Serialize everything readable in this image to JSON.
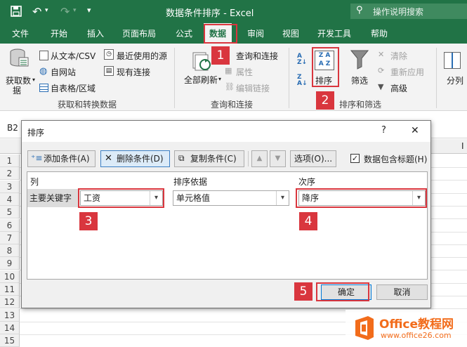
{
  "titlebar": {
    "window_title": "数据条件排序  -  Excel",
    "search_placeholder": "操作说明搜索"
  },
  "tabs": [
    {
      "label": "文件"
    },
    {
      "label": "开始"
    },
    {
      "label": "插入"
    },
    {
      "label": "页面布局"
    },
    {
      "label": "公式"
    },
    {
      "label": "数据"
    },
    {
      "label": "审阅"
    },
    {
      "label": "视图"
    },
    {
      "label": "开发工具"
    },
    {
      "label": "帮助"
    }
  ],
  "ribbon": {
    "get_data_line1": "获取数",
    "get_data_line2": "据",
    "from_text_csv": "从文本/CSV",
    "from_web": "自网站",
    "from_table": "自表格/区域",
    "recent_sources": "最近使用的源",
    "existing_connections": "现有连接",
    "group_get_transform": "获取和转换数据",
    "refresh_all": "全部刷新",
    "queries_connections": "查询和连接",
    "properties": "属性",
    "edit_links": "编辑链接",
    "group_queries": "查询和连接",
    "sort": "排序",
    "filter": "筛选",
    "clear": "清除",
    "reapply": "重新应用",
    "advanced": "高级",
    "group_sort_filter": "排序和筛选",
    "text_to_columns": "分列"
  },
  "sheet": {
    "name_box": "B2",
    "rows": [
      "1",
      "2",
      "3",
      "4",
      "5",
      "6",
      "7",
      "8",
      "9",
      "10",
      "11",
      "12",
      "13",
      "14",
      "15"
    ],
    "col_fragment": "I"
  },
  "dialog": {
    "title": "排序",
    "help": "?",
    "close": "✕",
    "add_level": "添加条件(A)",
    "delete_level": "删除条件(D)",
    "copy_level": "复制条件(C)",
    "options": "选项(O)...",
    "has_headers": "数据包含标题(H)",
    "has_headers_checked": true,
    "col_header_column": "列",
    "col_header_sort_on": "排序依据",
    "col_header_order": "次序",
    "row_label": "主要关键字",
    "column_value": "工资",
    "sort_on_value": "单元格值",
    "order_value": "降序",
    "ok": "确定",
    "cancel": "取消"
  },
  "callouts": [
    "1",
    "2",
    "3",
    "4",
    "5"
  ],
  "watermark": {
    "brand": "Office教程网",
    "url": "www.office26.com"
  },
  "colors": {
    "excel_green": "#217346",
    "callout_red": "#d9363e",
    "watermark_orange": "#f26c1b"
  }
}
